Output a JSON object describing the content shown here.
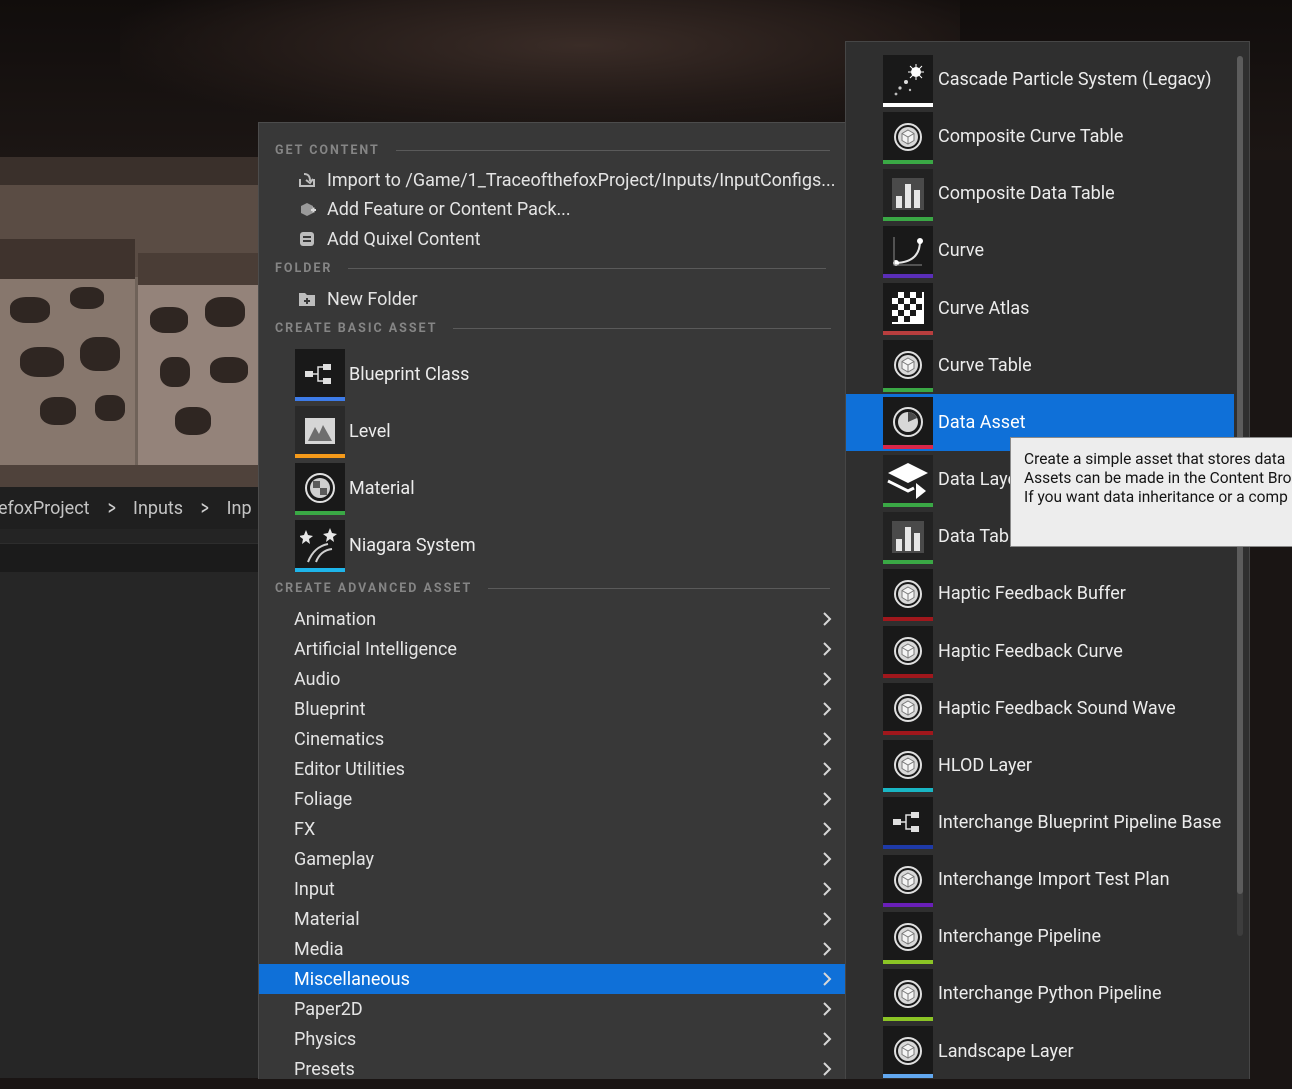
{
  "breadcrumb": {
    "items": [
      "efoxProject",
      "Inputs",
      "Inp"
    ],
    "separator": ">"
  },
  "main_menu": {
    "get_content": {
      "header": "GET CONTENT",
      "items": [
        {
          "label": "Import to /Game/1_TraceofthefoxProject/Inputs/InputConfigs...",
          "icon": "import-icon"
        },
        {
          "label": "Add Feature or Content Pack...",
          "icon": "feature-pack-icon"
        },
        {
          "label": "Add Quixel Content",
          "icon": "quixel-icon"
        }
      ]
    },
    "folder": {
      "header": "FOLDER",
      "items": [
        {
          "label": "New Folder",
          "icon": "new-folder-icon"
        }
      ]
    },
    "basic": {
      "header": "CREATE BASIC ASSET",
      "items": [
        {
          "label": "Blueprint Class",
          "icon": "blueprint-class-icon",
          "color": "#3d7be8"
        },
        {
          "label": "Level",
          "icon": "level-icon",
          "color": "#f59a1a"
        },
        {
          "label": "Material",
          "icon": "material-icon",
          "color": "#3aa845"
        },
        {
          "label": "Niagara System",
          "icon": "niagara-system-icon",
          "color": "#1eb5ea"
        }
      ]
    },
    "advanced": {
      "header": "CREATE ADVANCED ASSET",
      "selected": "Miscellaneous",
      "items": [
        "Animation",
        "Artificial Intelligence",
        "Audio",
        "Blueprint",
        "Cinematics",
        "Editor Utilities",
        "Foliage",
        "FX",
        "Gameplay",
        "Input",
        "Material",
        "Media",
        "Miscellaneous",
        "Paper2D",
        "Physics",
        "Presets"
      ]
    }
  },
  "sub_menu": {
    "selected": "Data Asset",
    "items": [
      {
        "label": "Cascade Particle System (Legacy)",
        "icon": "particle-system-icon",
        "color": "#ffffff"
      },
      {
        "label": "Composite Curve Table",
        "icon": "asset-cube-icon",
        "color": "#3aa845"
      },
      {
        "label": "Composite Data Table",
        "icon": "data-table-icon",
        "color": "#3aa845"
      },
      {
        "label": "Curve",
        "icon": "curve-icon",
        "color": "#5a2eb8"
      },
      {
        "label": "Curve Atlas",
        "icon": "curve-atlas-icon",
        "color": "#b83e3e"
      },
      {
        "label": "Curve Table",
        "icon": "asset-cube-icon",
        "color": "#3aa845"
      },
      {
        "label": "Data Asset",
        "icon": "data-asset-icon",
        "color": "#d9264a"
      },
      {
        "label": "Data Layer",
        "icon": "data-layer-icon",
        "color": "#3aa845"
      },
      {
        "label": "Data Table",
        "icon": "data-table-icon",
        "color": "#3aa845"
      },
      {
        "label": "Haptic Feedback Buffer",
        "icon": "asset-cube-icon",
        "color": "#a0171c"
      },
      {
        "label": "Haptic Feedback Curve",
        "icon": "asset-cube-icon",
        "color": "#a0171c"
      },
      {
        "label": "Haptic Feedback Sound Wave",
        "icon": "asset-cube-icon",
        "color": "#a0171c"
      },
      {
        "label": "HLOD Layer",
        "icon": "asset-cube-icon",
        "color": "#19b6c4"
      },
      {
        "label": "Interchange Blueprint Pipeline Base",
        "icon": "blueprint-class-icon",
        "color": "#1e3aa8"
      },
      {
        "label": "Interchange Import Test Plan",
        "icon": "asset-cube-icon",
        "color": "#6a1fb8"
      },
      {
        "label": "Interchange Pipeline",
        "icon": "asset-cube-icon",
        "color": "#8bc425"
      },
      {
        "label": "Interchange Python Pipeline",
        "icon": "asset-cube-icon",
        "color": "#8bc425"
      },
      {
        "label": "Landscape Layer",
        "icon": "asset-cube-icon",
        "color": "#62a8f0"
      }
    ]
  },
  "tooltip": {
    "lines": [
      "Create a simple asset that stores data",
      "Assets can be made in the Content Bro",
      "If you want data inheritance or a comp"
    ]
  }
}
